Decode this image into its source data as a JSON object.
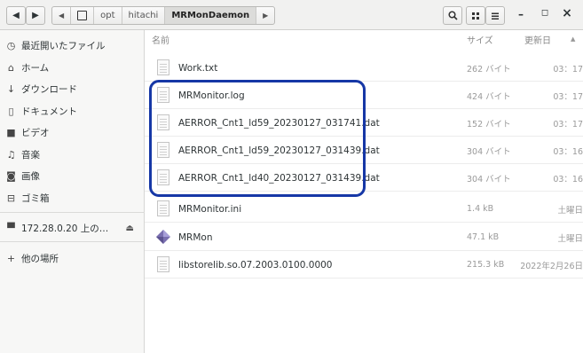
{
  "toolbar": {
    "back_icon": "chevron-left",
    "forward_icon": "chevron-right",
    "crumb_prev_icon": "chevron-left",
    "crumb_next_icon": "chevron-right",
    "breadcrumbs": [
      "opt",
      "hitachi",
      "MRMonDaemon"
    ],
    "search_icon": "magnifier",
    "view_icon": "grid-dots",
    "menu_icon": "hamburger",
    "minimize": "–",
    "maximize": "◻",
    "close": "×"
  },
  "sidebar": {
    "items": [
      {
        "icon": "clock",
        "glyph": "◷",
        "label": "最近開いたファイル"
      },
      {
        "icon": "home",
        "glyph": "⌂",
        "label": "ホーム"
      },
      {
        "icon": "download",
        "glyph": "↓",
        "label": "ダウンロード"
      },
      {
        "icon": "document",
        "glyph": "▯",
        "label": "ドキュメント"
      },
      {
        "icon": "video",
        "glyph": "■",
        "label": "ビデオ"
      },
      {
        "icon": "music",
        "glyph": "♫",
        "label": "音楽"
      },
      {
        "icon": "camera",
        "glyph": "◙",
        "label": "画像"
      },
      {
        "icon": "trash",
        "glyph": "⊟",
        "label": "ゴミ箱"
      },
      {
        "icon": "network-drive",
        "glyph": "▀",
        "label": "172.28.0.20 上の…",
        "eject": "⏏"
      },
      {
        "icon": "plus",
        "glyph": "+",
        "label": "他の場所"
      }
    ]
  },
  "columns": {
    "name": "名前",
    "size": "サイズ",
    "modified": "更新日",
    "sort_icon": "▲"
  },
  "files": [
    {
      "name": "Work.txt",
      "size": "262 バイト",
      "modified": "03：17",
      "icon": "text-file"
    },
    {
      "name": "MRMonitor.log",
      "size": "424 バイト",
      "modified": "03：17",
      "icon": "text-file"
    },
    {
      "name": "AERROR_Cnt1_ld59_20230127_031741.dat",
      "size": "152 バイト",
      "modified": "03：17",
      "icon": "text-file"
    },
    {
      "name": "AERROR_Cnt1_ld59_20230127_031439.dat",
      "size": "304 バイト",
      "modified": "03：16",
      "icon": "text-file"
    },
    {
      "name": "AERROR_Cnt1_ld40_20230127_031439.dat",
      "size": "304 バイト",
      "modified": "03：16",
      "icon": "text-file"
    },
    {
      "name": "MRMonitor.ini",
      "size": "1.4 kB",
      "modified": "土曜日",
      "icon": "text-file"
    },
    {
      "name": "MRMon",
      "size": "47.1 kB",
      "modified": "土曜日",
      "icon": "executable"
    },
    {
      "name": "libstorelib.so.07.2003.0100.0000",
      "size": "215.3 kB",
      "modified": "2022年2月26日",
      "icon": "text-file"
    }
  ],
  "highlight_color": "#1637a6"
}
